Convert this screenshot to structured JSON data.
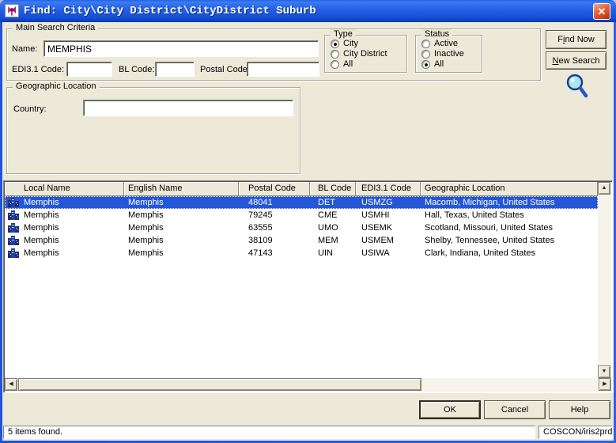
{
  "window": {
    "title": "Find: City\\City District\\CityDistrict Suburb",
    "close_glyph": "✕"
  },
  "main_search": {
    "group_label": "Main Search Criteria",
    "name": {
      "label": "Name:",
      "value": "MEMPHIS"
    },
    "edi31_code": {
      "label": "EDI3.1 Code:",
      "value": ""
    },
    "bl_code": {
      "label": "BL Code:",
      "value": ""
    },
    "postal_code": {
      "label": "Postal Code:",
      "value": ""
    }
  },
  "type_group": {
    "label": "Type",
    "options": [
      {
        "label": "City",
        "selected": true
      },
      {
        "label": "City District",
        "selected": false
      },
      {
        "label": "All",
        "selected": false
      }
    ]
  },
  "status_group": {
    "label": "Status",
    "options": [
      {
        "label": "Active",
        "selected": false
      },
      {
        "label": "Inactive",
        "selected": false
      },
      {
        "label": "All",
        "selected": true
      }
    ]
  },
  "buttons": {
    "find_now_pre": "F",
    "find_now_key": "i",
    "find_now_post": "nd Now",
    "new_search_key": "N",
    "new_search_post": "ew Search",
    "ok": "OK",
    "cancel": "Cancel",
    "help": "Help"
  },
  "geographic": {
    "group_label": "Geographic Location",
    "country": {
      "label": "Country:",
      "value": ""
    }
  },
  "results": {
    "columns": [
      "Local Name",
      "English Name",
      "Postal Code",
      "BL Code",
      "EDI3.1 Code",
      "Geographic Location"
    ],
    "rows": [
      {
        "local_name": "Memphis",
        "english_name": "Memphis",
        "postal_code": "48041",
        "bl_code": "DET",
        "edi31_code": "USMZG",
        "geographic_location": "Macomb, Michigan, United States",
        "selected": true
      },
      {
        "local_name": "Memphis",
        "english_name": "Memphis",
        "postal_code": "79245",
        "bl_code": "CME",
        "edi31_code": "USMHI",
        "geographic_location": "Hall, Texas, United States",
        "selected": false
      },
      {
        "local_name": "Memphis",
        "english_name": "Memphis",
        "postal_code": "63555",
        "bl_code": "UMO",
        "edi31_code": "USEMK",
        "geographic_location": "Scotland, Missouri, United States",
        "selected": false
      },
      {
        "local_name": "Memphis",
        "english_name": "Memphis",
        "postal_code": "38109",
        "bl_code": "MEM",
        "edi31_code": "USMEM",
        "geographic_location": "Shelby, Tennessee, United States",
        "selected": false
      },
      {
        "local_name": "Memphis",
        "english_name": "Memphis",
        "postal_code": "47143",
        "bl_code": "UIN",
        "edi31_code": "USIWA",
        "geographic_location": "Clark, Indiana, United States",
        "selected": false
      }
    ]
  },
  "status_bar": {
    "left": "5 items found.",
    "right": "COSCON/iris2prd"
  },
  "icons": {
    "title_icon": "app-flower-icon",
    "magnifier": "search-magnifier-icon",
    "row_icon": "city-buildings-icon"
  },
  "colors": {
    "titlebar_blue": "#1C57E0",
    "window_border_blue": "#2E63E0",
    "client_bg": "#ECE9D8",
    "selection_blue": "#2456D6",
    "close_button_red": "#CE4520",
    "field_bg": "#FFFFFF"
  }
}
